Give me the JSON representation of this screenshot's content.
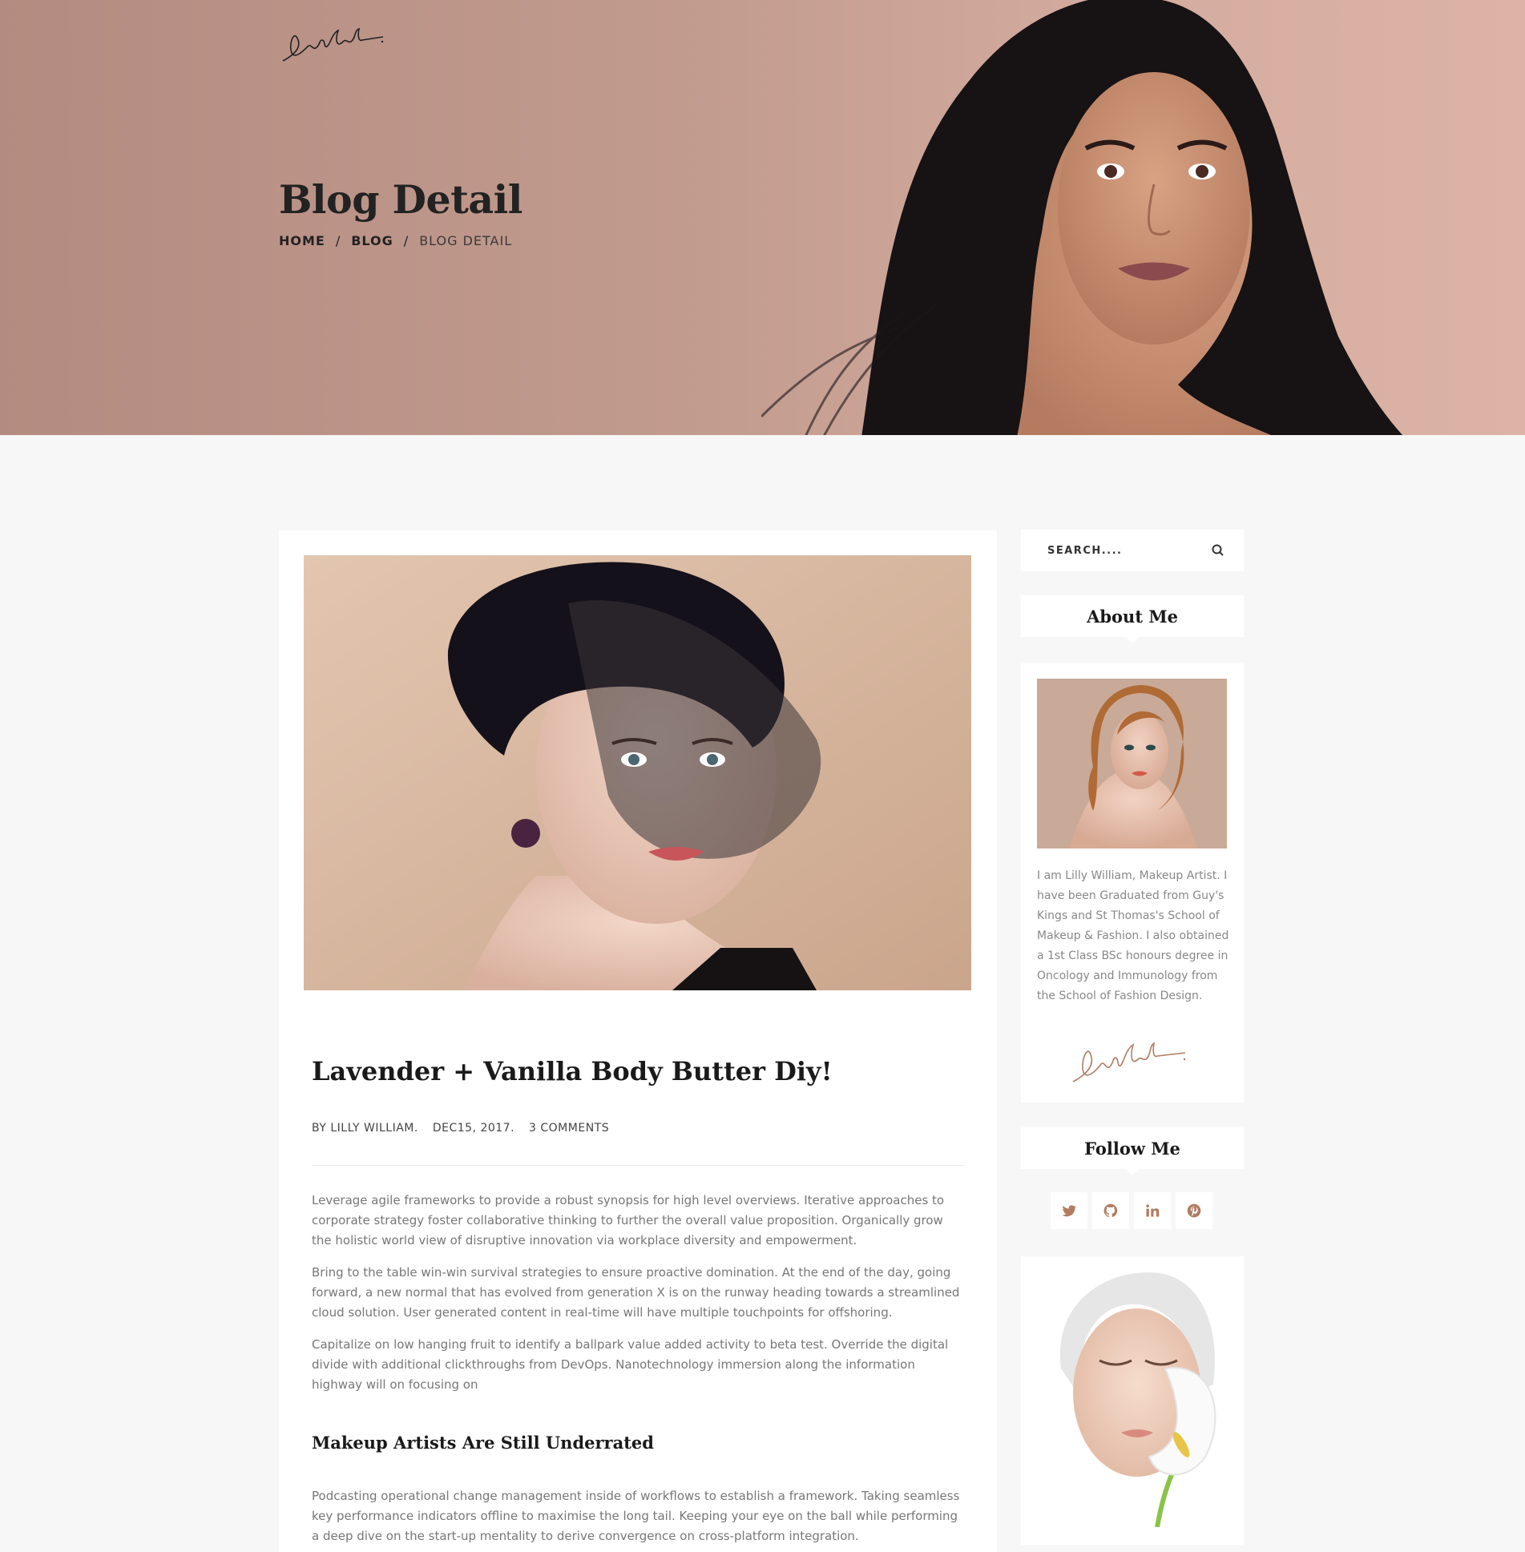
{
  "hero": {
    "title": "Blog Detail",
    "breadcrumb": [
      "HOME",
      "BLOG",
      "BLOG DETAIL"
    ]
  },
  "post": {
    "title": "Lavender + Vanilla Body Butter Diy!",
    "meta": {
      "author": "BY LILLY WILLIAM.",
      "date": "DEC15, 2017.",
      "comments": "3 COMMENTS"
    },
    "paragraphs": [
      "Leverage agile frameworks to provide a robust synopsis for high level overviews. Iterative approaches to corporate strategy foster collaborative thinking to further the overall value proposition. Organically grow the holistic world view of disruptive innovation via workplace diversity and empowerment.",
      "Bring to the table win-win survival strategies to ensure proactive domination. At the end of the day, going forward, a new normal that has evolved from generation X is on the runway heading towards a streamlined cloud solution. User generated content in real-time will have multiple touchpoints for offshoring.",
      "Capitalize on low hanging fruit to identify a ballpark value added activity to beta test. Override the digital divide with additional clickthroughs from DevOps. Nanotechnology immersion along the information highway will on focusing on"
    ],
    "subheading": "Makeup Artists Are Still Underrated",
    "paragraph4": "Podcasting operational change management inside of workflows to establish a framework. Taking seamless key performance indicators offline to maximise the long tail. Keeping your eye on the ball while performing a deep dive on the start-up mentality to derive convergence on cross-platform integration."
  },
  "sidebar": {
    "search_placeholder": "SEARCH....",
    "about_title": "About Me",
    "about_text": "I am Lilly William, Makeup Artist. I have been Graduated from Guy's Kings and St Thomas's School of Makeup & Fashion. I also obtained a 1st Class BSc honours degree in Oncology and Immunology from the School of Fashion Design.",
    "follow_title": "Follow Me",
    "social_icons": [
      "twitter-icon",
      "github-icon",
      "linkedin-icon",
      "pinterest-icon"
    ]
  },
  "colors": {
    "accent": "#b07d62",
    "hero_bg": "#c29b8f",
    "page_bg": "#f7f7f7"
  },
  "signature_text": "LaraCroft"
}
